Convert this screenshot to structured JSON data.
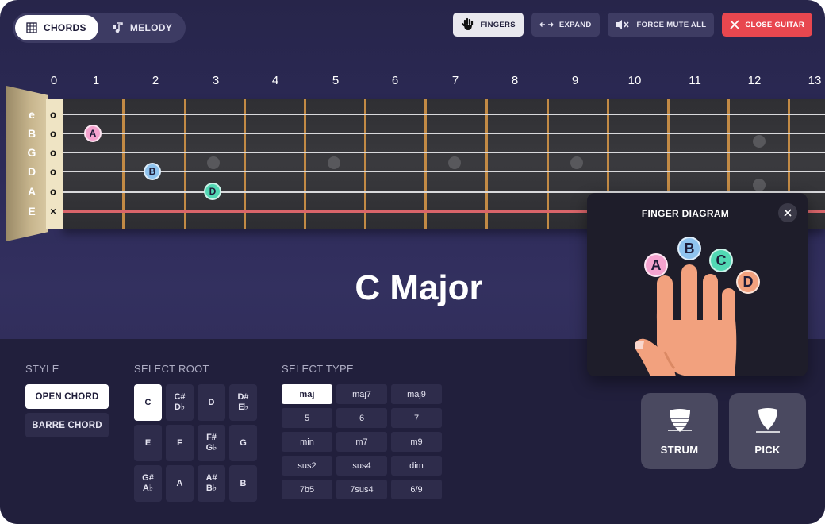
{
  "mode_toggle": {
    "chords_label": "CHORDS",
    "melody_label": "MELODY",
    "selected": "CHORDS"
  },
  "toolbar": {
    "fingers_label": "FINGERS",
    "expand_label": "EXPAND",
    "mute_label": "FORCE MUTE ALL",
    "close_label": "CLOSE GUITAR"
  },
  "fretboard": {
    "fret_numbers": [
      "0",
      "1",
      "2",
      "3",
      "4",
      "5",
      "6",
      "7",
      "8",
      "9",
      "10",
      "11",
      "12",
      "13"
    ],
    "strings": [
      "e",
      "B",
      "G",
      "D",
      "A",
      "E"
    ],
    "open_marks": [
      "o",
      "o",
      "o",
      "o",
      "o",
      "×"
    ],
    "fingers": [
      {
        "label": "A",
        "string": "B",
        "fret": 1,
        "color": "#f5a3cf"
      },
      {
        "label": "B",
        "string": "D",
        "fret": 2,
        "color": "#8fc3ee"
      },
      {
        "label": "D",
        "string": "A",
        "fret": 3,
        "color": "#52d8b4"
      }
    ]
  },
  "chord_name": "C Major",
  "style": {
    "title": "STYLE",
    "options": [
      "OPEN CHORD",
      "BARRE CHORD"
    ],
    "selected": "OPEN CHORD"
  },
  "root": {
    "title": "SELECT ROOT",
    "options": [
      {
        "line1": "C",
        "line2": ""
      },
      {
        "line1": "C#",
        "line2": "D♭"
      },
      {
        "line1": "D",
        "line2": ""
      },
      {
        "line1": "D#",
        "line2": "E♭"
      },
      {
        "line1": "E",
        "line2": ""
      },
      {
        "line1": "F",
        "line2": ""
      },
      {
        "line1": "F#",
        "line2": "G♭"
      },
      {
        "line1": "G",
        "line2": ""
      },
      {
        "line1": "G#",
        "line2": "A♭"
      },
      {
        "line1": "A",
        "line2": ""
      },
      {
        "line1": "A#",
        "line2": "B♭"
      },
      {
        "line1": "B",
        "line2": ""
      }
    ],
    "selected": "C"
  },
  "type": {
    "title": "SELECT TYPE",
    "options": [
      "maj",
      "maj7",
      "maj9",
      "5",
      "6",
      "7",
      "min",
      "m7",
      "m9",
      "sus2",
      "sus4",
      "dim",
      "7b5",
      "7sus4",
      "6/9"
    ],
    "selected": "maj"
  },
  "finger_diagram": {
    "title": "FINGER DIAGRAM",
    "fingers": [
      {
        "label": "A",
        "color": "#f5a3cf"
      },
      {
        "label": "B",
        "color": "#8fc3ee"
      },
      {
        "label": "C",
        "color": "#52d8b4"
      },
      {
        "label": "D",
        "color": "#f2a17e"
      }
    ]
  },
  "actions": {
    "strum_label": "STRUM",
    "pick_label": "PICK"
  },
  "colors": {
    "accent_danger": "#e8474f",
    "fret_wire": "#c28a45",
    "muted_string": "#d9656a",
    "skin": "#f2a17e"
  }
}
